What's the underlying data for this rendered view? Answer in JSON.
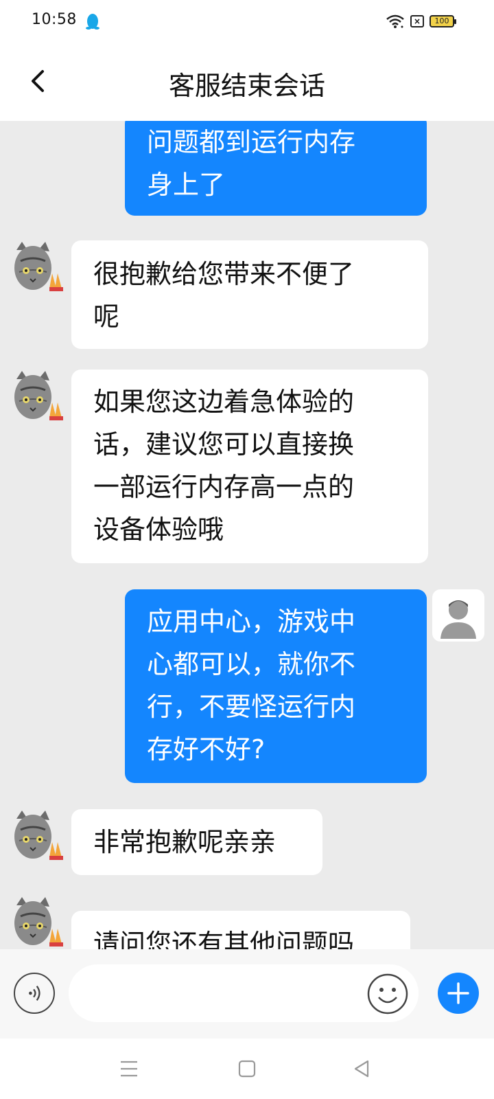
{
  "status_bar": {
    "time": "10:58",
    "battery_level": "100",
    "icons": [
      "qq-penguin-icon",
      "wifi-icon",
      "sim-x-icon",
      "battery-icon"
    ]
  },
  "header": {
    "title": "客服结束会话",
    "back_icon": "chevron-left-icon"
  },
  "messages": [
    {
      "sender": "user",
      "text": "问题都到运行内存\n身上了"
    },
    {
      "sender": "agent",
      "text": "很抱歉给您带来不便了\n呢"
    },
    {
      "sender": "agent",
      "text": "如果您这边着急体验的\n话，建议您可以直接换\n一部运行内存高一点的\n设备体验哦"
    },
    {
      "sender": "user",
      "text": "应用中心，游戏中\n心都可以，就你不\n行，不要怪运行内\n存好不好?"
    },
    {
      "sender": "agent",
      "text": "非常抱歉呢亲亲"
    },
    {
      "sender": "agent",
      "text": "请问您还有其他问题吗"
    }
  ],
  "input_bar": {
    "placeholder": "",
    "value": "",
    "voice_icon": "voice-icon",
    "emoji_icon": "emoji-icon",
    "plus_icon": "plus-icon"
  },
  "nav_bar": {
    "icons": [
      "menu-icon",
      "home-square-icon",
      "back-triangle-icon"
    ]
  },
  "colors": {
    "accent": "#1486fe",
    "chat_background": "#ebebeb",
    "incoming_bubble": "#ffffff",
    "outgoing_text": "#ffffff"
  }
}
